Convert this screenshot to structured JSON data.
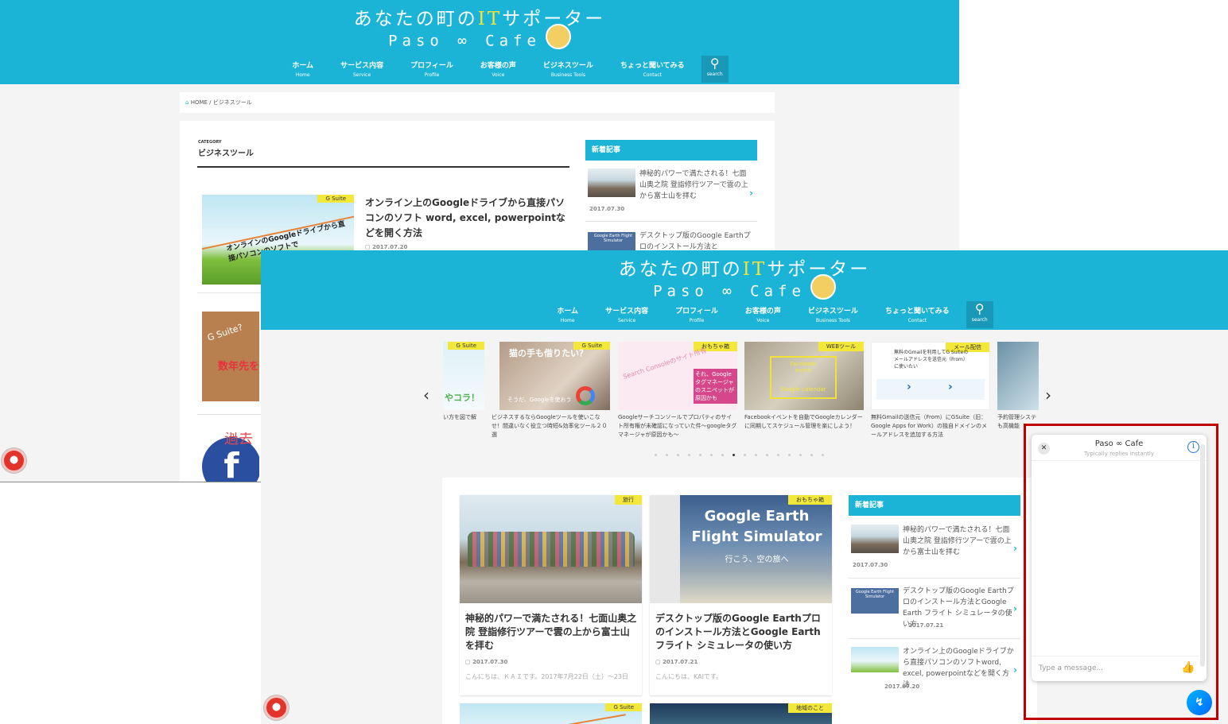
{
  "site": {
    "title_a": "あなたの町の",
    "title_it": "IT",
    "title_b": "サポーター",
    "subtitle": "Paso ∞ Cafe"
  },
  "nav": [
    {
      "ja": "ホーム",
      "en": "Home"
    },
    {
      "ja": "サービス内容",
      "en": "Service"
    },
    {
      "ja": "プロフィール",
      "en": "Profile"
    },
    {
      "ja": "お客様の声",
      "en": "Voice"
    },
    {
      "ja": "ビジネスツール",
      "en": "Business Tools"
    },
    {
      "ja": "ちょっと聞いてみる",
      "en": "Contact"
    }
  ],
  "search_label": "search",
  "back_page": {
    "breadcrumb_home": "HOME",
    "breadcrumb_sep": "/",
    "breadcrumb_current": "ビジネスツール",
    "category_kicker": "CATEGORY",
    "category_title": "ビジネスツール",
    "article1": {
      "tag": "G Suite",
      "thumb_text": "オンラインのGoogleドライブから直接パソコンのソフトで",
      "title": "オンライン上のGoogleドライブから直接パソコンのソフト word, excel, powerpointなどを開く方法",
      "date": "2017.07.20"
    },
    "article2": {
      "thumb_text_a": "G Suite?",
      "thumb_text_b": "数年先を"
    },
    "article3": {
      "thumb_text": "過去"
    },
    "sidebar": {
      "heading": "新着記事",
      "items": [
        {
          "title": "神秘的パワーで満たされる！七面山奥之院 登詣修行ツアーで雲の上から富士山を拝む",
          "date": "2017.07.30"
        },
        {
          "title": "デスクトップ版のGoogle Earthプロのインストール方法と",
          "thumb_text": "Google Earth Flight Simulator"
        }
      ]
    }
  },
  "front_page": {
    "carousel": [
      {
        "tag": "G Suite",
        "thumb_text": "やコラ！",
        "caption": "い方を図で解"
      },
      {
        "tag": "G Suite",
        "thumb_text": "猫の手も借りたい？",
        "thumb_text_b": "そうだ、Googleを使おう",
        "caption": "ビジネスするならGoogleツールを使いこなせ！間違いなく役立つ時短&効率化ツール２０選"
      },
      {
        "tag": "おもちゃ箱",
        "thumb_text": "Search Consoleのサイト所有",
        "thumb_text_b": "それ、Googleタグマネージャのスニペットが原因かも",
        "caption": "Googleサーチコンソールでプロパティのサイト所有権が未確認になっていた件～googleタグマネージャが原因かも～"
      },
      {
        "tag": "WEBツール",
        "thumb_text": "Facebook event",
        "thumb_text_b": "Google calendar",
        "caption": "Facebookイベントを自動でGoogleカレンダーに同期してスケジュール管理を楽にしよう！"
      },
      {
        "tag": "メール配信",
        "thumb_text": "無料のGmailを利用してG Suiteのメールアドレスを送信元（From）に使いたい",
        "caption": "無料Gmailの送信元（From）にGSuite（旧：Google Apps for Work）の独自ドメインのメールアドレスを追加する方法"
      },
      {
        "caption": "予約管理システも高機能"
      }
    ],
    "posts": [
      {
        "tag": "旅行",
        "title": "神秘的パワーで満たされる！七面山奥之院 登詣修行ツアーで雲の上から富士山を拝む",
        "date": "2017.07.30",
        "excerpt": "こんにちは、ＫＡＩです。2017年7月22日（土）～23日"
      },
      {
        "tag": "おもちゃ箱",
        "thumb_title": "Google Earth",
        "thumb_title_b": "Flight Simulator",
        "thumb_sub": "行こう、空の旅へ",
        "title": "デスクトップ版のGoogle Earthプロのインストール方法とGoogle Earth フライト シミュレータの使い方",
        "date": "2017.07.21",
        "excerpt": "こんにちは、KAIです。"
      },
      {
        "tag": "G Suite"
      },
      {
        "tag": "地域のこと"
      }
    ],
    "sidebar": {
      "heading": "新着記事",
      "items": [
        {
          "title": "神秘的パワーで満たされる！七面山奥之院 登詣修行ツアーで雲の上から富士山を拝む",
          "date": "2017.07.30"
        },
        {
          "title": "デスクトップ版のGoogle Earthプロのインストール方法とGoogle Earth フライト シミュレータの使い方",
          "date": "2017.07.21",
          "thumb_text": "Google Earth Flight Simulator"
        },
        {
          "title": "オンライン上のGoogleドライブから直接パソコンのソフトword, excel, powerpointなどを開く方法",
          "date": "2017.07.20"
        }
      ]
    },
    "chat": {
      "name": "Paso ∞ Cafe",
      "status": "Typically replies instantly",
      "placeholder": "Type a message..."
    }
  },
  "colors": {
    "header": "#1cb4d6",
    "accent_yellow": "#f3e73a",
    "highlight_box": "#c00000",
    "notify_red": "#e3342b"
  }
}
